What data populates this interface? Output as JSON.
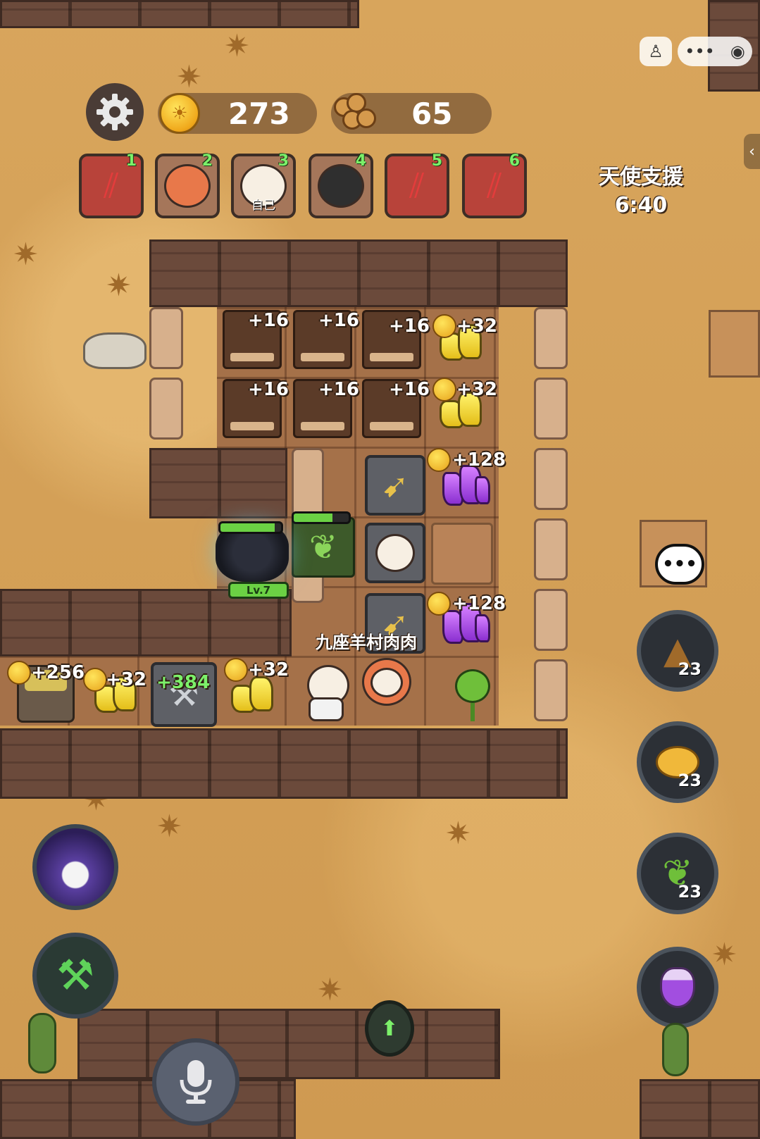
{
  "hud": {
    "coins": "273",
    "wood": "65",
    "icons": {
      "settings": "gear-icon",
      "coin": "coin-icon",
      "wood": "wood-logs-icon"
    }
  },
  "players": [
    {
      "num": "1",
      "kind": "claw-marks"
    },
    {
      "num": "2",
      "kind": "fox-hood-sheep"
    },
    {
      "num": "3",
      "kind": "witch-sheep",
      "label": "自己"
    },
    {
      "num": "4",
      "kind": "black-sheep"
    },
    {
      "num": "5",
      "kind": "claw-marks"
    },
    {
      "num": "6",
      "kind": "claw-marks"
    }
  ],
  "event": {
    "title": "天使支援",
    "timer": "6:40"
  },
  "tiles": {
    "crate_rows": [
      "+16",
      "+16",
      "+16"
    ],
    "gold_row1": "+32",
    "gold_row2": "+32",
    "gem_top": "+128",
    "gem_bottom": "+128",
    "house": "+256",
    "gold_left": "+32",
    "tools": "+384",
    "gold_mid": "+32"
  },
  "wolf": {
    "level": "Lv.7"
  },
  "player_name": "九座羊村肉肉",
  "side_buttons": [
    {
      "icon": "poop-icon",
      "count": "23"
    },
    {
      "icon": "piggy-bank-icon",
      "count": "23"
    },
    {
      "icon": "thorn-vine-icon",
      "count": "23"
    },
    {
      "icon": "potion-icon",
      "count": ""
    }
  ],
  "colors": {
    "ground": "#d9a75e",
    "wall": "#6b4a3b",
    "floor": "#a57149",
    "accent_green": "#7cf06a"
  }
}
